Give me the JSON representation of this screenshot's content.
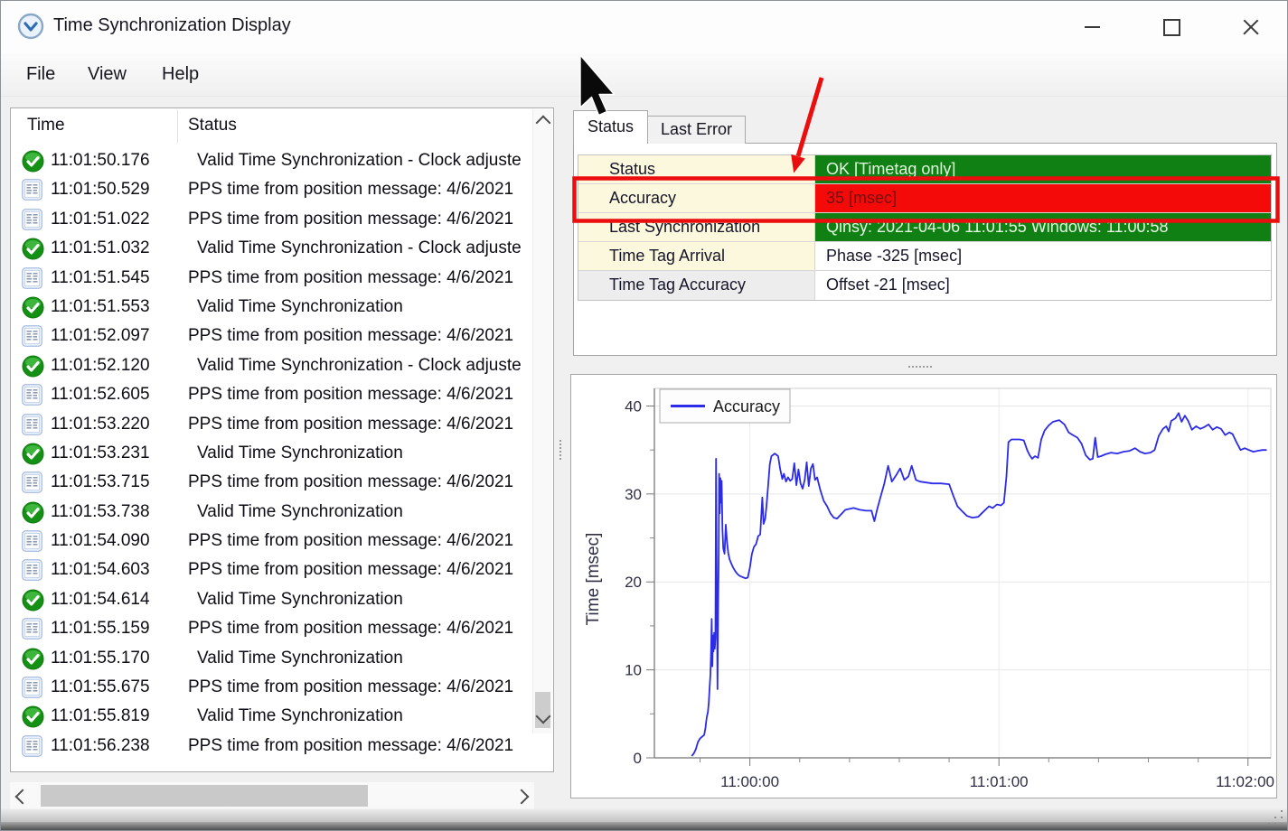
{
  "window": {
    "title": "Time Synchronization Display",
    "controls": [
      "minimize",
      "maximize",
      "close"
    ],
    "app_icon": "clock-chevron-icon"
  },
  "menu": {
    "items": [
      "File",
      "View",
      "Help"
    ]
  },
  "log": {
    "columns": [
      "Time",
      "Status"
    ],
    "rows": [
      {
        "icon": "check",
        "time": "11:01:50.176",
        "status": "Valid Time Synchronization - Clock adjuste"
      },
      {
        "icon": "doc",
        "time": "11:01:50.529",
        "status": "PPS time from position message: 4/6/2021"
      },
      {
        "icon": "doc",
        "time": "11:01:51.022",
        "status": "PPS time from position message: 4/6/2021"
      },
      {
        "icon": "check",
        "time": "11:01:51.032",
        "status": "Valid Time Synchronization - Clock adjuste"
      },
      {
        "icon": "doc",
        "time": "11:01:51.545",
        "status": "PPS time from position message: 4/6/2021"
      },
      {
        "icon": "check",
        "time": "11:01:51.553",
        "status": "Valid Time Synchronization"
      },
      {
        "icon": "doc",
        "time": "11:01:52.097",
        "status": "PPS time from position message: 4/6/2021"
      },
      {
        "icon": "check",
        "time": "11:01:52.120",
        "status": "Valid Time Synchronization - Clock adjuste"
      },
      {
        "icon": "doc",
        "time": "11:01:52.605",
        "status": "PPS time from position message: 4/6/2021"
      },
      {
        "icon": "doc",
        "time": "11:01:53.220",
        "status": "PPS time from position message: 4/6/2021"
      },
      {
        "icon": "check",
        "time": "11:01:53.231",
        "status": "Valid Time Synchronization"
      },
      {
        "icon": "doc",
        "time": "11:01:53.715",
        "status": "PPS time from position message: 4/6/2021"
      },
      {
        "icon": "check",
        "time": "11:01:53.738",
        "status": "Valid Time Synchronization"
      },
      {
        "icon": "doc",
        "time": "11:01:54.090",
        "status": "PPS time from position message: 4/6/2021"
      },
      {
        "icon": "doc",
        "time": "11:01:54.603",
        "status": "PPS time from position message: 4/6/2021"
      },
      {
        "icon": "check",
        "time": "11:01:54.614",
        "status": "Valid Time Synchronization"
      },
      {
        "icon": "doc",
        "time": "11:01:55.159",
        "status": "PPS time from position message: 4/6/2021"
      },
      {
        "icon": "check",
        "time": "11:01:55.170",
        "status": "Valid Time Synchronization"
      },
      {
        "icon": "doc",
        "time": "11:01:55.675",
        "status": "PPS time from position message: 4/6/2021"
      },
      {
        "icon": "check",
        "time": "11:01:55.819",
        "status": "Valid Time Synchronization"
      },
      {
        "icon": "doc",
        "time": "11:01:56.238",
        "status": "PPS time from position message: 4/6/2021"
      }
    ]
  },
  "status_panel": {
    "tabs": [
      {
        "label": "Status",
        "active": true
      },
      {
        "label": "Last Error",
        "active": false
      }
    ],
    "rows": [
      {
        "label": "Status",
        "value": "OK [Timetag only]",
        "label_bg": "#FBF8DD",
        "value_bg": "#108014",
        "value_color": "#E2F4DE"
      },
      {
        "label": "Accuracy",
        "value": "35 [msec]",
        "label_bg": "#FBF8DD",
        "value_bg": "#F50A0A",
        "value_color": "#701212",
        "highlighted": true
      },
      {
        "label": "Last Synchronization",
        "value": "Qinsy: 2021-04-06 11:01:55 Windows: 11:00:58",
        "label_bg": "#FBF8DD",
        "value_bg": "#108014",
        "value_color": "#E2F4DE"
      },
      {
        "label": "Time Tag Arrival",
        "value": "Phase -325 [msec]",
        "label_bg": "#FBF8DD",
        "value_bg": "#FFFFFF",
        "value_color": "#15152B"
      },
      {
        "label": "Time Tag Accuracy",
        "value": "Offset -21 [msec]",
        "label_bg": "#EDEDED",
        "value_bg": "#FFFFFF",
        "value_color": "#15152B"
      }
    ]
  },
  "annotation": {
    "color": "#EB0E0E"
  },
  "chart_data": {
    "type": "line",
    "title": "",
    "xlabel": "",
    "ylabel": "Time [msec]",
    "legend_position": "top-left",
    "grid": true,
    "xlim": [
      -23,
      125.5
    ],
    "ylim": [
      0,
      42
    ],
    "yticks": [
      0,
      10,
      20,
      30,
      40
    ],
    "xticks": [
      {
        "t": 0,
        "label": "11:00:00"
      },
      {
        "t": 60,
        "label": "11:01:00"
      },
      {
        "t": 120,
        "label": "11:02:00"
      }
    ],
    "x_minor": 12,
    "y_minor": 5,
    "x_unit": "seconds relative to 11:00:00",
    "series": [
      {
        "name": "Accuracy",
        "color": "#2B2BE8",
        "points": [
          [
            -14,
            0.2
          ],
          [
            -13.5,
            0.5
          ],
          [
            -13,
            1
          ],
          [
            -12.5,
            1.8
          ],
          [
            -12,
            2.2
          ],
          [
            -11.5,
            2.4
          ],
          [
            -11,
            2.6
          ],
          [
            -10.7,
            3.4
          ],
          [
            -10.4,
            4.6
          ],
          [
            -10.1,
            5.2
          ],
          [
            -9.9,
            6.3
          ],
          [
            -9.7,
            8
          ],
          [
            -9.5,
            9.5
          ],
          [
            -9.35,
            12
          ],
          [
            -9.2,
            15.8
          ],
          [
            -9.05,
            10.4
          ],
          [
            -8.9,
            13.9
          ],
          [
            -8.75,
            12.1
          ],
          [
            -8.6,
            14.2
          ],
          [
            -8.45,
            12.4
          ],
          [
            -8.3,
            13.6
          ],
          [
            -8.15,
            34
          ],
          [
            -8,
            22
          ],
          [
            -7.9,
            16
          ],
          [
            -7.8,
            7.8
          ],
          [
            -7.65,
            17
          ],
          [
            -7.5,
            23.4
          ],
          [
            -7.4,
            32.3
          ],
          [
            -7.25,
            27.8
          ],
          [
            -7.1,
            31.8
          ],
          [
            -6.95,
            29
          ],
          [
            -6.8,
            31.5
          ],
          [
            -6.6,
            26
          ],
          [
            -6.4,
            23.8
          ],
          [
            -6.1,
            23.2
          ],
          [
            -5.8,
            26.5
          ],
          [
            -5.5,
            24.5
          ],
          [
            -5.2,
            23.3
          ],
          [
            -4.9,
            22.6
          ],
          [
            -4.5,
            22.1
          ],
          [
            -4,
            21.6
          ],
          [
            -3.5,
            21.2
          ],
          [
            -3,
            20.9
          ],
          [
            -2.5,
            20.7
          ],
          [
            -2,
            20.6
          ],
          [
            -1.5,
            20.5
          ],
          [
            -1,
            20.4
          ],
          [
            -0.5,
            20.5
          ],
          [
            0,
            21.6
          ],
          [
            0.5,
            23.2
          ],
          [
            1,
            24
          ],
          [
            1.5,
            24.3
          ],
          [
            2,
            25.2
          ],
          [
            2.5,
            25.4
          ],
          [
            3,
            29.6
          ],
          [
            3.3,
            26.6
          ],
          [
            3.7,
            27.2
          ],
          [
            4,
            28.6
          ],
          [
            4.4,
            30.9
          ],
          [
            4.8,
            33.4
          ],
          [
            5.2,
            34.3
          ],
          [
            6,
            34.6
          ],
          [
            6.8,
            34.3
          ],
          [
            7.3,
            32.8
          ],
          [
            7.8,
            31.7
          ],
          [
            8.2,
            32.3
          ],
          [
            8.7,
            31.4
          ],
          [
            9.2,
            31.9
          ],
          [
            9.7,
            31.5
          ],
          [
            10.2,
            31.7
          ],
          [
            10.7,
            33.5
          ],
          [
            11.2,
            31
          ],
          [
            11.7,
            32.8
          ],
          [
            12.2,
            31.2
          ],
          [
            12.7,
            30.6
          ],
          [
            13.2,
            31.6
          ],
          [
            13.7,
            33.6
          ],
          [
            14.2,
            30.9
          ],
          [
            14.7,
            32.9
          ],
          [
            15.2,
            33.4
          ],
          [
            15.7,
            31.6
          ],
          [
            16.2,
            31.9
          ],
          [
            17,
            30.4
          ],
          [
            17.8,
            29.2
          ],
          [
            18.6,
            28.6
          ],
          [
            19.4,
            27.8
          ],
          [
            20.2,
            27.3
          ],
          [
            21,
            27.2
          ],
          [
            22,
            27.7
          ],
          [
            23,
            28.2
          ],
          [
            24,
            28.3
          ],
          [
            25,
            28.4
          ],
          [
            26.5,
            28.2
          ],
          [
            28,
            28.1
          ],
          [
            29.3,
            28.1
          ],
          [
            30,
            26.9
          ],
          [
            30.7,
            28.3
          ],
          [
            31.5,
            29.7
          ],
          [
            32.4,
            31.2
          ],
          [
            33.3,
            33.2
          ],
          [
            34.2,
            31.4
          ],
          [
            35.2,
            32.1
          ],
          [
            36.2,
            32.9
          ],
          [
            37.2,
            31.6
          ],
          [
            38.2,
            32
          ],
          [
            39,
            33.2
          ],
          [
            40,
            31.6
          ],
          [
            41,
            31.4
          ],
          [
            42.5,
            31.3
          ],
          [
            44,
            31.2
          ],
          [
            46,
            31.2
          ],
          [
            48,
            31.1
          ],
          [
            49,
            29.8
          ],
          [
            50,
            28.6
          ],
          [
            51,
            28.1
          ],
          [
            52.3,
            27.5
          ],
          [
            53.6,
            27.3
          ],
          [
            55,
            27.4
          ],
          [
            56.3,
            28
          ],
          [
            57.6,
            28.6
          ],
          [
            58.5,
            28.4
          ],
          [
            59.5,
            28.8
          ],
          [
            60.5,
            28.7
          ],
          [
            61.2,
            29
          ],
          [
            61.8,
            32
          ],
          [
            62.3,
            35.9
          ],
          [
            63,
            36.2
          ],
          [
            64,
            36.2
          ],
          [
            65,
            36.2
          ],
          [
            66,
            36.1
          ],
          [
            66.8,
            35
          ],
          [
            67.4,
            34.4
          ],
          [
            68,
            34
          ],
          [
            68.7,
            34.3
          ],
          [
            69.4,
            34.1
          ],
          [
            70.2,
            36.2
          ],
          [
            71,
            37.2
          ],
          [
            72,
            37.8
          ],
          [
            73,
            38.2
          ],
          [
            74.5,
            38.4
          ],
          [
            75.8,
            37.9
          ],
          [
            76.8,
            37
          ],
          [
            77.8,
            36.7
          ],
          [
            78.9,
            36.4
          ],
          [
            79.9,
            35.7
          ],
          [
            80.9,
            34.4
          ],
          [
            81.9,
            33.9
          ],
          [
            82.6,
            34
          ],
          [
            83.2,
            36.4
          ],
          [
            83.8,
            34.2
          ],
          [
            84.6,
            34.3
          ],
          [
            85.6,
            34.5
          ],
          [
            87,
            34.7
          ],
          [
            88.5,
            34.6
          ],
          [
            90,
            34.8
          ],
          [
            91.5,
            34.9
          ],
          [
            92.8,
            35.2
          ],
          [
            94,
            34.8
          ],
          [
            95.2,
            34.6
          ],
          [
            96.5,
            34.7
          ],
          [
            97.5,
            35
          ],
          [
            98.5,
            36.6
          ],
          [
            99.5,
            37.4
          ],
          [
            100.3,
            37.7
          ],
          [
            100.9,
            37.1
          ],
          [
            101.5,
            38.3
          ],
          [
            102.5,
            38.6
          ],
          [
            103.3,
            39.2
          ],
          [
            104,
            38.2
          ],
          [
            104.8,
            38.9
          ],
          [
            105.6,
            38.3
          ],
          [
            106.5,
            37.3
          ],
          [
            107.5,
            37.7
          ],
          [
            108.5,
            37.4
          ],
          [
            109.5,
            37.6
          ],
          [
            110.5,
            37.9
          ],
          [
            111.5,
            37.3
          ],
          [
            112.5,
            37.6
          ],
          [
            113.5,
            37.4
          ],
          [
            114.5,
            36.7
          ],
          [
            115.5,
            37
          ],
          [
            116.3,
            36.8
          ],
          [
            117.2,
            35.9
          ],
          [
            118.2,
            35
          ],
          [
            119.2,
            35.2
          ],
          [
            120.2,
            35
          ],
          [
            121.3,
            34.8
          ],
          [
            122.3,
            34.9
          ],
          [
            123.5,
            35
          ],
          [
            124.5,
            35
          ]
        ]
      }
    ]
  }
}
